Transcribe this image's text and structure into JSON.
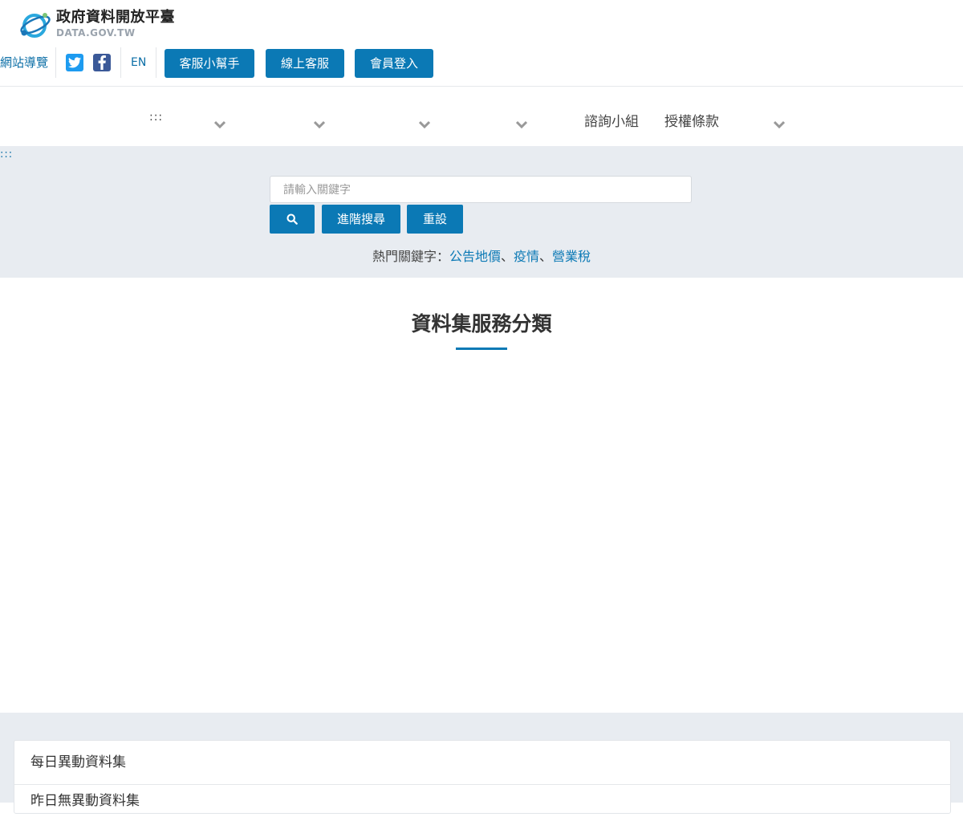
{
  "header": {
    "logo_name": "政府資料開放平臺",
    "logo_domain": "DATA.GOV.TW",
    "site_nav_label": "網站導覽",
    "lang_label": "EN",
    "buttons": [
      "客服小幫手",
      "線上客服",
      "會員登入"
    ]
  },
  "icons": {
    "twitter": "twitter-icon",
    "facebook": "facebook-icon",
    "chevron": "chevron-down-icon",
    "search": "search-icon"
  },
  "nav": {
    "accesskey": ":::",
    "items": [
      "諮詢小組",
      "授權條款"
    ]
  },
  "search": {
    "skip_label": ":::",
    "placeholder": "請輸入關鍵字",
    "advanced_label": "進階搜尋",
    "reset_label": "重設",
    "hot_label": "熱門關鍵字：",
    "hot_keywords": [
      "公告地價",
      "疫情",
      "營業稅"
    ],
    "separator": "、"
  },
  "section": {
    "title": "資料集服務分類"
  },
  "panel": {
    "rows": [
      "每日異動資料集",
      "昨日無異動資料集"
    ]
  },
  "colors": {
    "primary": "#0b79b5",
    "link": "#0b6ea6",
    "band": "#e8ecf1"
  }
}
